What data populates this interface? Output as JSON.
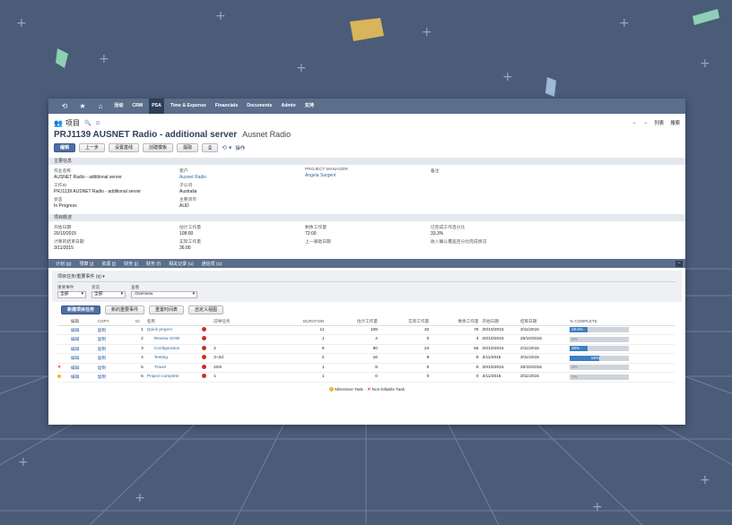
{
  "colors": {
    "background": "#4a5c78",
    "nav": "#5b6e8c",
    "accent": "#3f7fbf"
  },
  "nav": {
    "icons": [
      "history-icon",
      "star-icon",
      "home-icon"
    ],
    "items": [
      "活动",
      "CRM",
      "PSA",
      "Time & Expense",
      "Financials",
      "Documents",
      "Admin",
      "支持"
    ],
    "active_index": 2
  },
  "record": {
    "type_label": "项目",
    "title": "PRJ1139 AUSNET Radio - additional server",
    "subtitle": "Ausnet Radio",
    "nav_right": [
      "←",
      "→",
      "列表",
      "搜索"
    ]
  },
  "actions": {
    "edit": "编辑",
    "back": "上一步",
    "btn3": "设置基线",
    "btn4": "创建模板",
    "btn5": "提取",
    "print_icon": "print-icon",
    "more": "操作"
  },
  "primary_section": {
    "title": "主要信息",
    "fields": [
      {
        "label": "作业名称",
        "value": "AUSNET Radio - additional server",
        "link": false
      },
      {
        "label": "客户",
        "value": "Ausnet Radio",
        "link": true
      },
      {
        "label": "PROJECT MANAGER",
        "value": "Angela Sargent",
        "link": true
      },
      {
        "label": "备注",
        "value": "",
        "link": false
      },
      {
        "label": "工作ID",
        "value": "PRJ1139 AUSNET Radio - additional server",
        "link": false
      },
      {
        "label": "子公司",
        "value": "Australia",
        "link": false
      },
      {
        "label": "",
        "value": "",
        "link": false
      },
      {
        "label": "",
        "value": "",
        "link": false
      },
      {
        "label": "状态",
        "value": "In Progress",
        "link": false
      },
      {
        "label": "主要货币",
        "value": "AUD",
        "link": false
      },
      {
        "label": "",
        "value": "",
        "link": false
      },
      {
        "label": "",
        "value": "",
        "link": false
      }
    ]
  },
  "schedule_section": {
    "title": "项目概述",
    "fields": [
      {
        "label": "开始日期",
        "value": "20/10/2015"
      },
      {
        "label": "估计工作量",
        "value": "108:00"
      },
      {
        "label": "剩余工作量",
        "value": "72:00"
      },
      {
        "label": "已完成工作百分比",
        "value": "33.3%"
      },
      {
        "label": "计算的结束日期",
        "value": "3/11/2015"
      },
      {
        "label": "实际工作量",
        "value": "36:00"
      },
      {
        "label": "上一基础日期",
        "value": ""
      },
      {
        "label": "收入确认覆盖百分比完成情况",
        "value": ""
      }
    ]
  },
  "tabs": [
    "计划 (g)",
    "预算 (j)",
    "资源 (j)",
    "财务 (j)",
    "财务 (f)",
    "相关记录 (u)",
    "通信项 (u)"
  ],
  "sublist": {
    "title": "项目任务/重要事件 (q) ▾",
    "filters": [
      {
        "label": "重要事件",
        "value": "全部"
      },
      {
        "label": "状态",
        "value": "全部"
      },
      {
        "label": "查看",
        "value": ".Overview"
      }
    ],
    "buttons": [
      "新建项目任务",
      "新的重要事件",
      "重置时间表",
      "自定义视图"
    ]
  },
  "table": {
    "headers": [
      "",
      "编辑",
      "COPY",
      "ID",
      "名称",
      "",
      "前导任务",
      "DURATION",
      "估计工作量",
      "实际工作量",
      "剩余工作量",
      "开始日期",
      "结束日期",
      "% COMPLETE"
    ],
    "rows": [
      {
        "mark": "",
        "edit": "编辑",
        "copy": "复制",
        "id": "1",
        "name": "Quick project",
        "indent": 0,
        "dot": true,
        "pred": "",
        "duration": "11",
        "est": "108",
        "actual": "32",
        "remain": "76",
        "start": "20/10/2015",
        "end": "3/11/2015",
        "pct": 29.6,
        "pct_label": "29.6%"
      },
      {
        "mark": "",
        "edit": "编辑",
        "copy": "复制",
        "id": "2",
        "name": "Review SOW",
        "indent": 1,
        "dot": true,
        "pred": "",
        "duration": "1",
        "est": "4",
        "actual": "0",
        "remain": "4",
        "start": "20/10/2015",
        "end": "20/10/2015",
        "pct": 0,
        "pct_label": "0%"
      },
      {
        "mark": "",
        "edit": "编辑",
        "copy": "复制",
        "id": "3",
        "name": "Configuration",
        "indent": 1,
        "dot": true,
        "pred": "2",
        "duration": "9",
        "est": "80",
        "actual": "24",
        "remain": "56",
        "start": "20/10/2015",
        "end": "2/11/2015",
        "pct": 30,
        "pct_label": "30%"
      },
      {
        "mark": "",
        "edit": "编辑",
        "copy": "复制",
        "id": "4",
        "name": "Testing",
        "indent": 1,
        "dot": true,
        "pred": "3~2d",
        "duration": "2",
        "est": "16",
        "actual": "8",
        "remain": "8",
        "start": "3/11/2015",
        "end": "3/11/2015",
        "pct": 50,
        "pct_label": "50%"
      },
      {
        "mark": "x",
        "edit": "编辑",
        "copy": "复制",
        "id": "5",
        "name": "Travel",
        "indent": 1,
        "dot": true,
        "pred": "2SS",
        "duration": "1",
        "est": "8",
        "actual": "0",
        "remain": "8",
        "start": "20/10/2015",
        "end": "20/10/2015",
        "pct": 0,
        "pct_label": "0%"
      },
      {
        "mark": "milestone",
        "edit": "编辑",
        "copy": "复制",
        "id": "6",
        "name": "Project complete",
        "indent": 0,
        "dot": true,
        "pred": "1",
        "duration": "1",
        "est": "0",
        "actual": "0",
        "remain": "0",
        "start": "3/11/2015",
        "end": "3/11/2015",
        "pct": 0,
        "pct_label": "0%"
      }
    ]
  },
  "legend": {
    "milestone": "Milestone Task",
    "nonbillable": "Non-billable Task"
  }
}
